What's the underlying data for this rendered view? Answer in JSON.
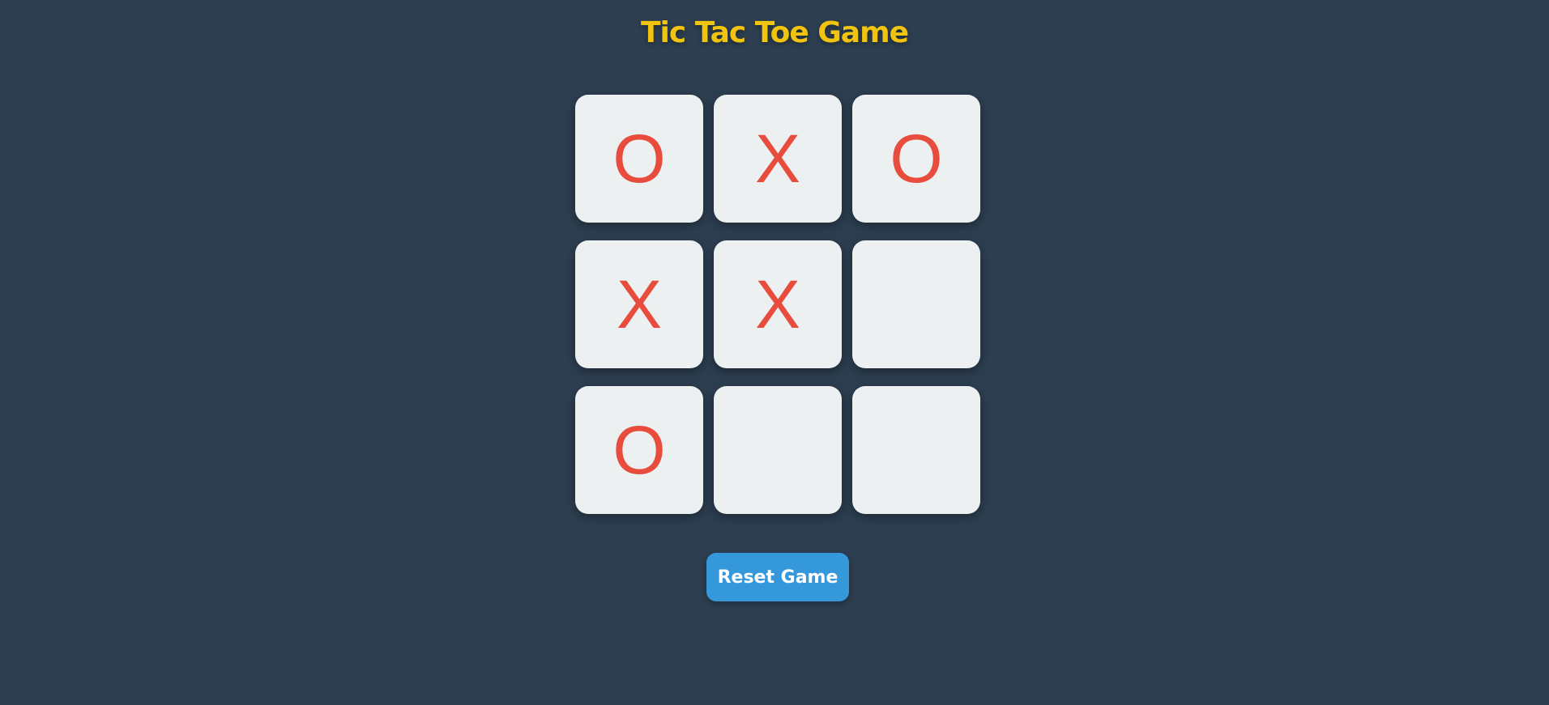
{
  "game": {
    "title": "Tic Tac Toe Game",
    "reset_label": "Reset Game",
    "board": [
      "O",
      "X",
      "O",
      "X",
      "X",
      "",
      "O",
      "",
      ""
    ]
  },
  "colors": {
    "background": "#2c3e50",
    "title": "#f1c40f",
    "cell_background": "#ecf0f1",
    "mark": "#e74c3c",
    "button": "#3498db",
    "button_text": "#ffffff"
  }
}
